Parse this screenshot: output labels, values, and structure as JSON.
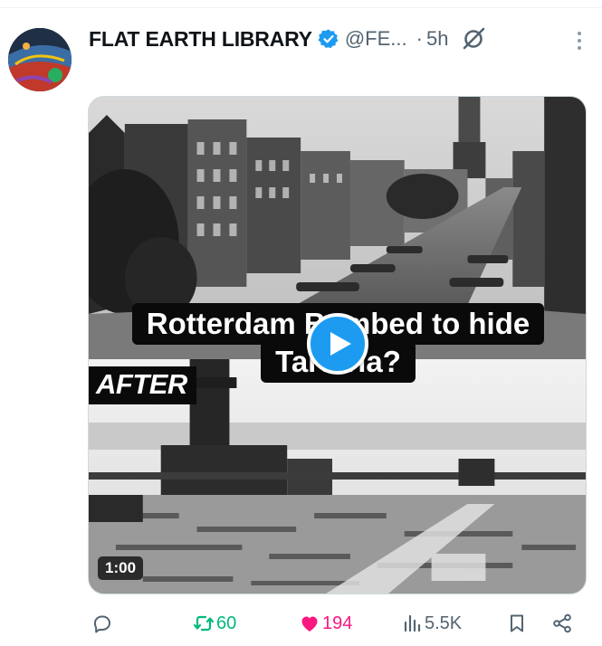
{
  "tweet": {
    "author": {
      "display_name": "FLAT EARTH LIBRARY",
      "handle": "@FE...",
      "verified": true,
      "avatar_icon": "avatar-earth-image"
    },
    "separator": "·",
    "time": "5h",
    "grok_icon": "grok-icon",
    "more_icon": "more-vertical-icon",
    "media": {
      "type": "video",
      "caption_line1": "Rotterdam Bombed to hide",
      "caption_line2": "Tartaria?",
      "after_label": "AFTER",
      "duration": "1:00",
      "play_icon": "play-icon",
      "accent_color": "#1d9bf0"
    },
    "actions": {
      "reply_icon": "reply-icon",
      "repost_icon": "repost-icon",
      "repost_count": "60",
      "like_icon": "heart-filled-icon",
      "like_count": "194",
      "views_icon": "views-icon",
      "views_count": "5.5K",
      "bookmark_icon": "bookmark-icon",
      "share_icon": "share-icon",
      "repost_color": "#00ba7c",
      "like_color": "#f91880"
    }
  }
}
